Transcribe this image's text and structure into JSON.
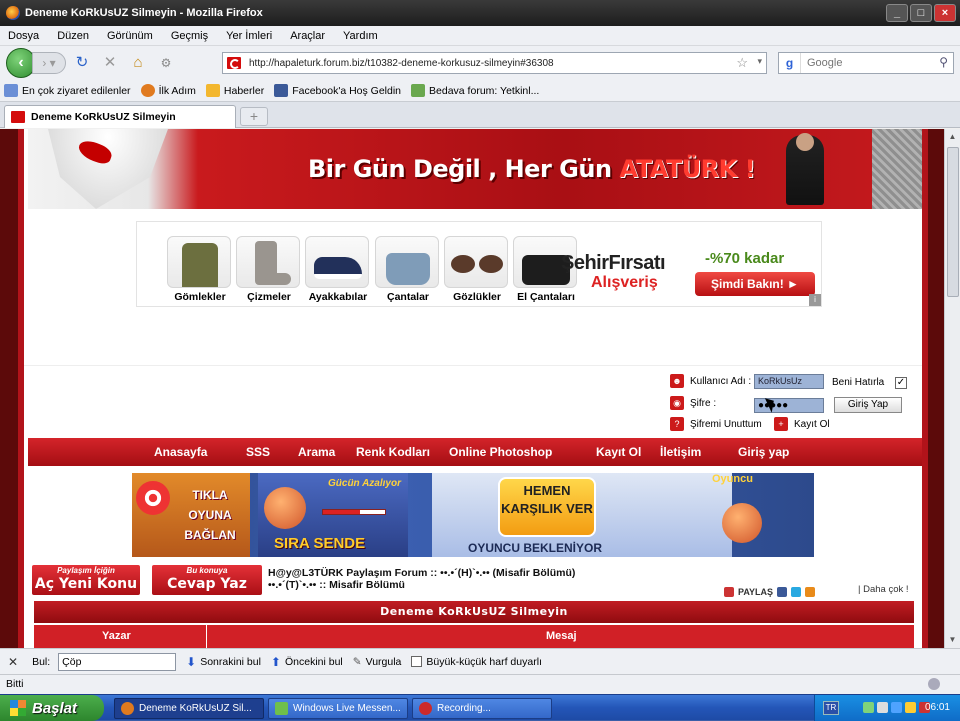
{
  "window": {
    "title": "Deneme KoRkUsUZ Silmeyin - Mozilla Firefox",
    "min": "_",
    "max": "□",
    "close": "×"
  },
  "menu": [
    "Dosya",
    "Düzen",
    "Görünüm",
    "Geçmiş",
    "Yer İmleri",
    "Araçlar",
    "Yardım"
  ],
  "toolbar": {
    "url": "http://hapaleturk.forum.biz/t10382-deneme-korkusuz-silmeyin#36308",
    "search_placeholder": "Google"
  },
  "bookmarks": [
    "En çok ziyaret edilenler",
    "İlk Adım",
    "Haberler",
    "Facebook'a Hoş Geldin",
    "Bedava forum: Yetkinl..."
  ],
  "tab": {
    "title": "Deneme KoRkUsUZ Silmeyin"
  },
  "banner": {
    "slogan_a": "Bir Gün Değil , Her Gün",
    "slogan_b": "ATATÜRK !"
  },
  "ad": {
    "items": [
      "Gömlekler",
      "Çizmeler",
      "Ayakkabılar",
      "Çantalar",
      "Gözlükler",
      "El Çantaları"
    ],
    "brand": "ŞehirFırsatı",
    "brand_sub": "Alışveriş",
    "discount": "-%70 kadar",
    "cta": "Şimdi Bakın! ►"
  },
  "login": {
    "user_label": "Kullanıcı Adı :",
    "user_value": "KoRkUsUz",
    "remember": "Beni Hatırla",
    "pass_label": "Şifre :",
    "pass_value": "●●●●●",
    "submit": "Giriş Yap",
    "forgot": "Şifremi Unuttum",
    "register": "Kayıt Ol"
  },
  "nav": [
    "Anasayfa",
    "SSS",
    "Arama",
    "Renk Kodları",
    "Online Photoshop",
    "Kayıt Ol",
    "İletişim",
    "Giriş yap"
  ],
  "game_ad": {
    "left": "TIKLA OYUNA BAĞLAN",
    "gucun": "Gücün Azalıyor",
    "sira": "SIRA SENDE",
    "hemen": "HEMEN KARŞILIK VER",
    "bekleniyor": "OYUNCU BEKLENİYOR",
    "oyuncu": "Oyuncu"
  },
  "actions": {
    "new_topic_small": "Paylaşım İçiğin",
    "new_topic": "Aç Yeni Konu",
    "reply_small": "Bu konuya",
    "reply": "Cevap Yaz",
    "crumb1": "H@y@L3TÜRK Paylaşım Forum :: ••.•´(H)`•.•• (Misafir Bölümü)",
    "crumb2": "••.•´(T)`•.•• :: Misafir Bölümü",
    "share": "PAYLAŞ",
    "daha": "| Daha çok !"
  },
  "thread": {
    "title": "Deneme KoRkUsUZ Silmeyin",
    "col_author": "Yazar",
    "col_message": "Mesaj"
  },
  "findbar": {
    "label": "Bul:",
    "value": "Çöp",
    "next": "Sonrakini bul",
    "prev": "Öncekini bul",
    "highlight": "Vurgula",
    "matchcase": "Büyük-küçük harf duyarlı"
  },
  "status": "Bitti",
  "taskbar": {
    "start": "Başlat",
    "items": [
      "Deneme KoRkUsUZ Sil...",
      "Windows Live Messen...",
      "Recording..."
    ],
    "lang": "TR",
    "clock": "06:01"
  }
}
